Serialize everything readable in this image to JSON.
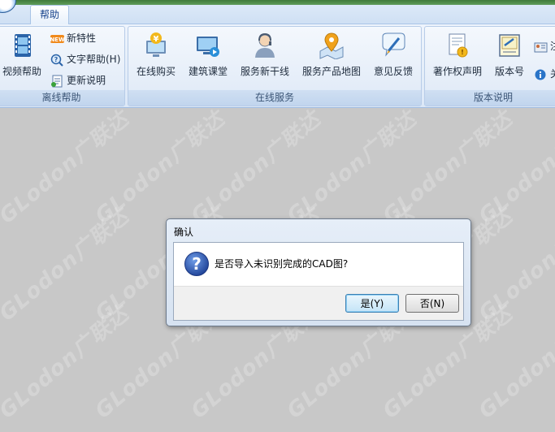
{
  "ribbon": {
    "active_tab": "帮助",
    "groups": {
      "offline_help": {
        "label": "离线帮助",
        "video_help": "视频帮助",
        "new_features": "新特性",
        "text_help": "文字帮助(H)",
        "update_notes": "更新说明"
      },
      "online_service": {
        "label": "在线服务",
        "buy_online": "在线购买",
        "building_class": "建筑课堂",
        "service_new_line": "服务新干线",
        "service_map": "服务产品地图",
        "feedback": "意见反馈"
      },
      "version_info": {
        "label": "版本说明",
        "copyright": "著作权声明",
        "version": "版本号",
        "reg_cut": "注",
        "about_cut": "关"
      }
    }
  },
  "watermark": "GLodon广联达",
  "dialog": {
    "title": "确认",
    "message": "是否导入未识别完成的CAD图?",
    "yes_label": "是(Y)",
    "no_label": "否(N)"
  }
}
